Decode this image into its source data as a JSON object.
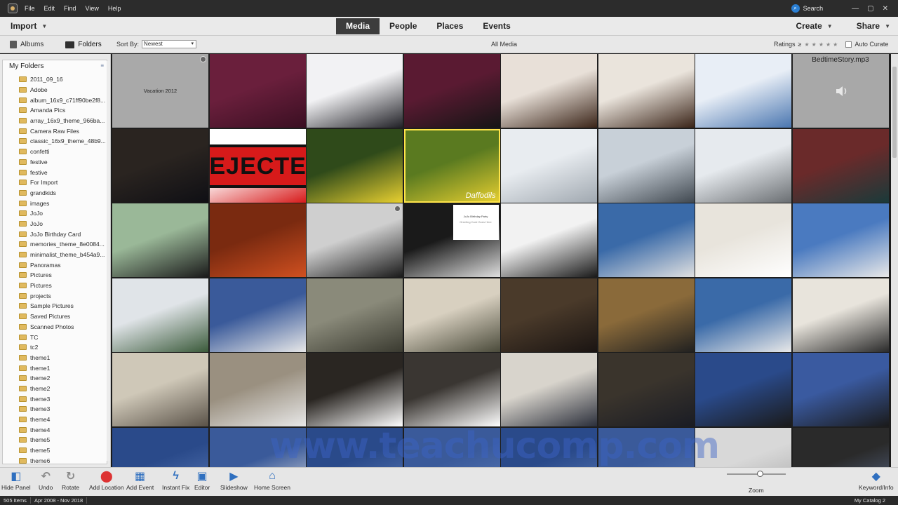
{
  "menubar": {
    "items": [
      "File",
      "Edit",
      "Find",
      "View",
      "Help"
    ],
    "search_label": "Search"
  },
  "toolbar": {
    "import_label": "Import",
    "tabs": [
      {
        "label": "Media",
        "active": true
      },
      {
        "label": "People"
      },
      {
        "label": "Places"
      },
      {
        "label": "Events"
      }
    ],
    "create_label": "Create",
    "share_label": "Share"
  },
  "subbar": {
    "albums_label": "Albums",
    "folders_label": "Folders",
    "sort_label": "Sort By:",
    "sort_value": "Newest",
    "title": "All Media",
    "ratings_label": "Ratings",
    "ratings_op": "≥",
    "stars": "★★★★★",
    "auto_curate_label": "Auto Curate"
  },
  "sidebar": {
    "header": "My Folders",
    "folders": [
      "2011_09_16",
      "Adobe",
      "album_16x9_c71ff90be2f8...",
      "Amanda Pics",
      "array_16x9_theme_966ba...",
      "Camera Raw Files",
      "classic_16x9_theme_48b9...",
      "confetti",
      "festive",
      "festive",
      "For Import",
      "grandkids",
      "images",
      "JoJo",
      "JoJo",
      "JoJo Birthday Card",
      "memories_theme_8e0084...",
      "minimalist_theme_b454a9...",
      "Panoramas",
      "Pictures",
      "Pictures",
      "projects",
      "Sample Pictures",
      "Saved Pictures",
      "Scanned Photos",
      "TC",
      "tc2",
      "theme1",
      "theme1",
      "theme2",
      "theme2",
      "theme3",
      "theme3",
      "theme4",
      "theme4",
      "theme5",
      "theme5",
      "theme6"
    ]
  },
  "grid": {
    "labels": {
      "vacation": "Vacation 2012",
      "mp3": "BedtimeStory.mp3",
      "ejected": "EJECTE",
      "daffodils": "Daffodils",
      "card_title": "JoJo Birthday Party",
      "card_sub": "Greeting Card Goes Here"
    }
  },
  "watermark": "www.teachucomp.com",
  "bottombar": {
    "buttons": [
      {
        "label": "Hide Panel",
        "icon": "hide-panel-icon"
      },
      {
        "label": "Undo",
        "icon": "undo-icon"
      },
      {
        "label": "Rotate",
        "icon": "rotate-icon"
      },
      {
        "label": "Add Location",
        "icon": "location-pin-icon"
      },
      {
        "label": "Add Event",
        "icon": "calendar-icon"
      },
      {
        "label": "Instant Fix",
        "icon": "lightning-icon"
      },
      {
        "label": "Editor",
        "icon": "editor-icon"
      },
      {
        "label": "Slideshow",
        "icon": "slideshow-icon"
      },
      {
        "label": "Home Screen",
        "icon": "home-icon"
      }
    ],
    "zoom_label": "Zoom",
    "zoom_level": 0.56,
    "keyword_info_label": "Keyword/Info"
  },
  "status": {
    "items_count": "505 Items",
    "date_range": "Apr 2008 - Nov 2018",
    "catalog": "My Catalog 2"
  },
  "colors": {
    "accent_blue": "#2f6fbf",
    "selection_yellow": "#ffe44a",
    "folder_yellow": "#e0b95e",
    "active_tab": "#3c3c3c"
  }
}
